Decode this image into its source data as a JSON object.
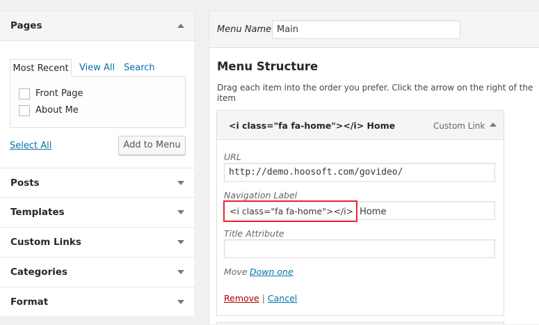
{
  "sidebar": {
    "pages": {
      "title": "Pages",
      "tabs": [
        "Most Recent",
        "View All",
        "Search"
      ],
      "items": [
        "Front Page",
        "About Me"
      ],
      "select_all": "Select All",
      "add_button": "Add to Menu"
    },
    "sections": [
      "Posts",
      "Templates",
      "Custom Links",
      "Categories",
      "Format"
    ]
  },
  "menu": {
    "name_label": "Menu Name",
    "name_value": "Main",
    "structure_title": "Menu Structure",
    "structure_desc": "Drag each item into the order you prefer. Click the arrow on the right of the item",
    "item": {
      "title": "<i class=\"fa fa-home\"></i> Home",
      "type": "Custom Link",
      "url_label": "URL",
      "url_value": "http://demo.hoosoft.com/govideo/",
      "nav_label": "Navigation Label",
      "nav_value_code": "<i class=\"fa fa-home\"></i>",
      "nav_value_text": "Home",
      "title_attr_label": "Title Attribute",
      "title_attr_value": "",
      "move_label": "Move",
      "move_link": "Down one",
      "remove": "Remove",
      "separator": "|",
      "cancel": "Cancel"
    }
  },
  "colors": {
    "highlight": "#e8242b",
    "link": "#0073aa",
    "remove": "#a00"
  }
}
